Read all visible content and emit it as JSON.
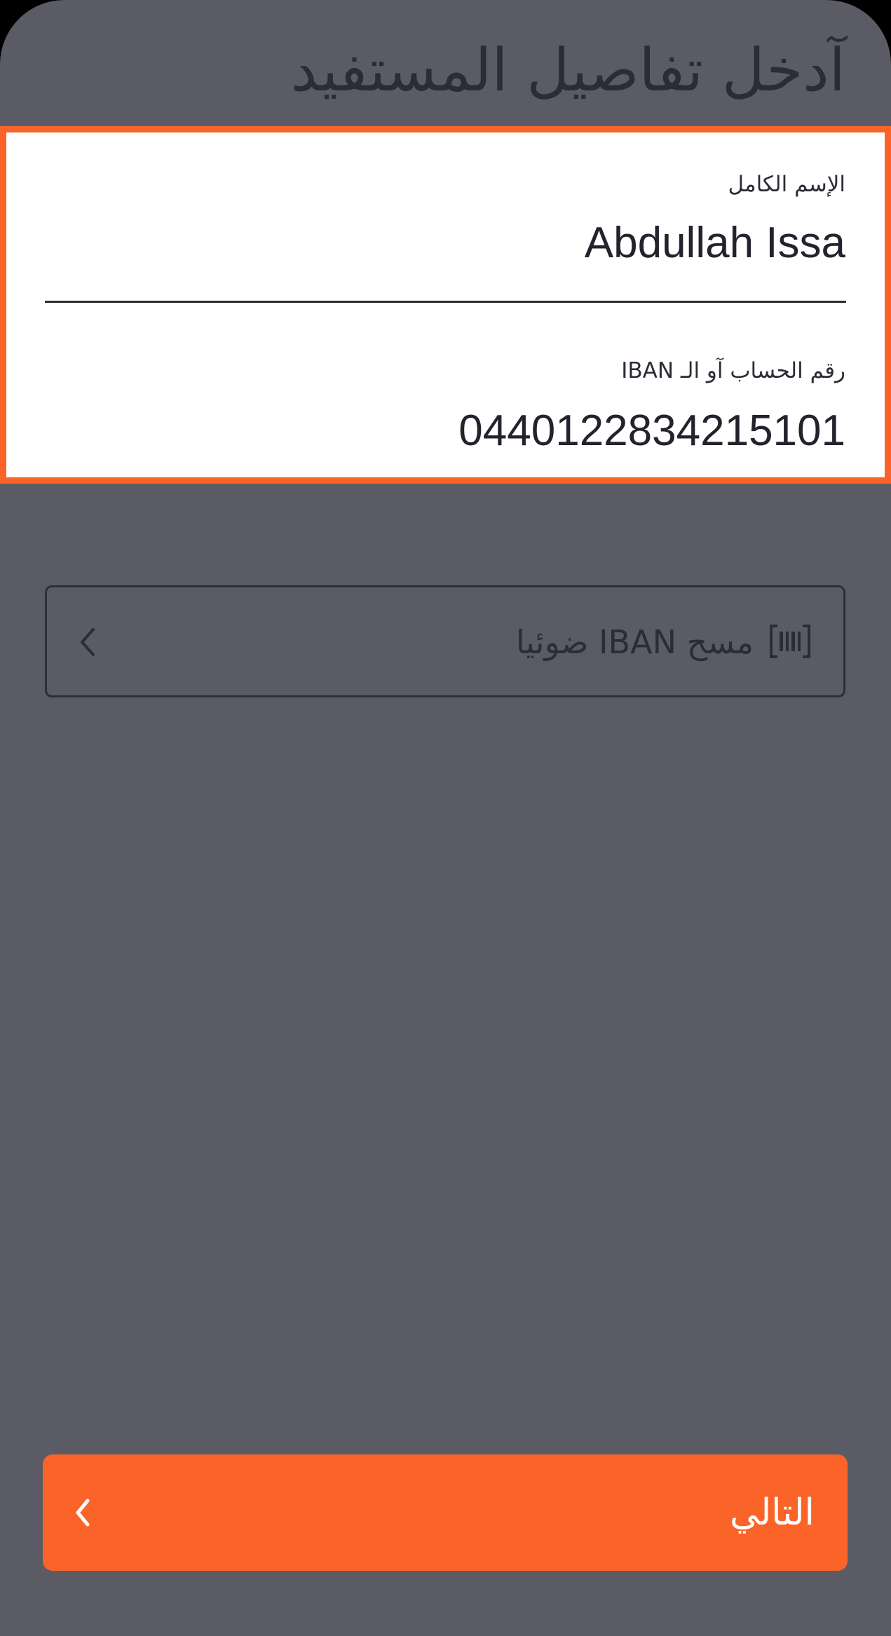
{
  "header": {
    "title": "آدخل تفاصيل المستفيد"
  },
  "form": {
    "full_name": {
      "label": "الإسم الكامل",
      "value": "Abdullah Issa"
    },
    "iban": {
      "label": "رقم الحساب آو الـ IBAN",
      "value": "0440122834215101"
    }
  },
  "scan": {
    "label": "مسح IBAN ضوئيا",
    "icon": "barcode-scan-icon",
    "chevron": "chevron-left-icon"
  },
  "footer": {
    "next_label": "التالي",
    "next_icon": "chevron-left-icon"
  },
  "colors": {
    "background": "#5b5b66",
    "accent": "#fa6428",
    "text_dark": "#2c2c36",
    "card": "#ffffff"
  }
}
